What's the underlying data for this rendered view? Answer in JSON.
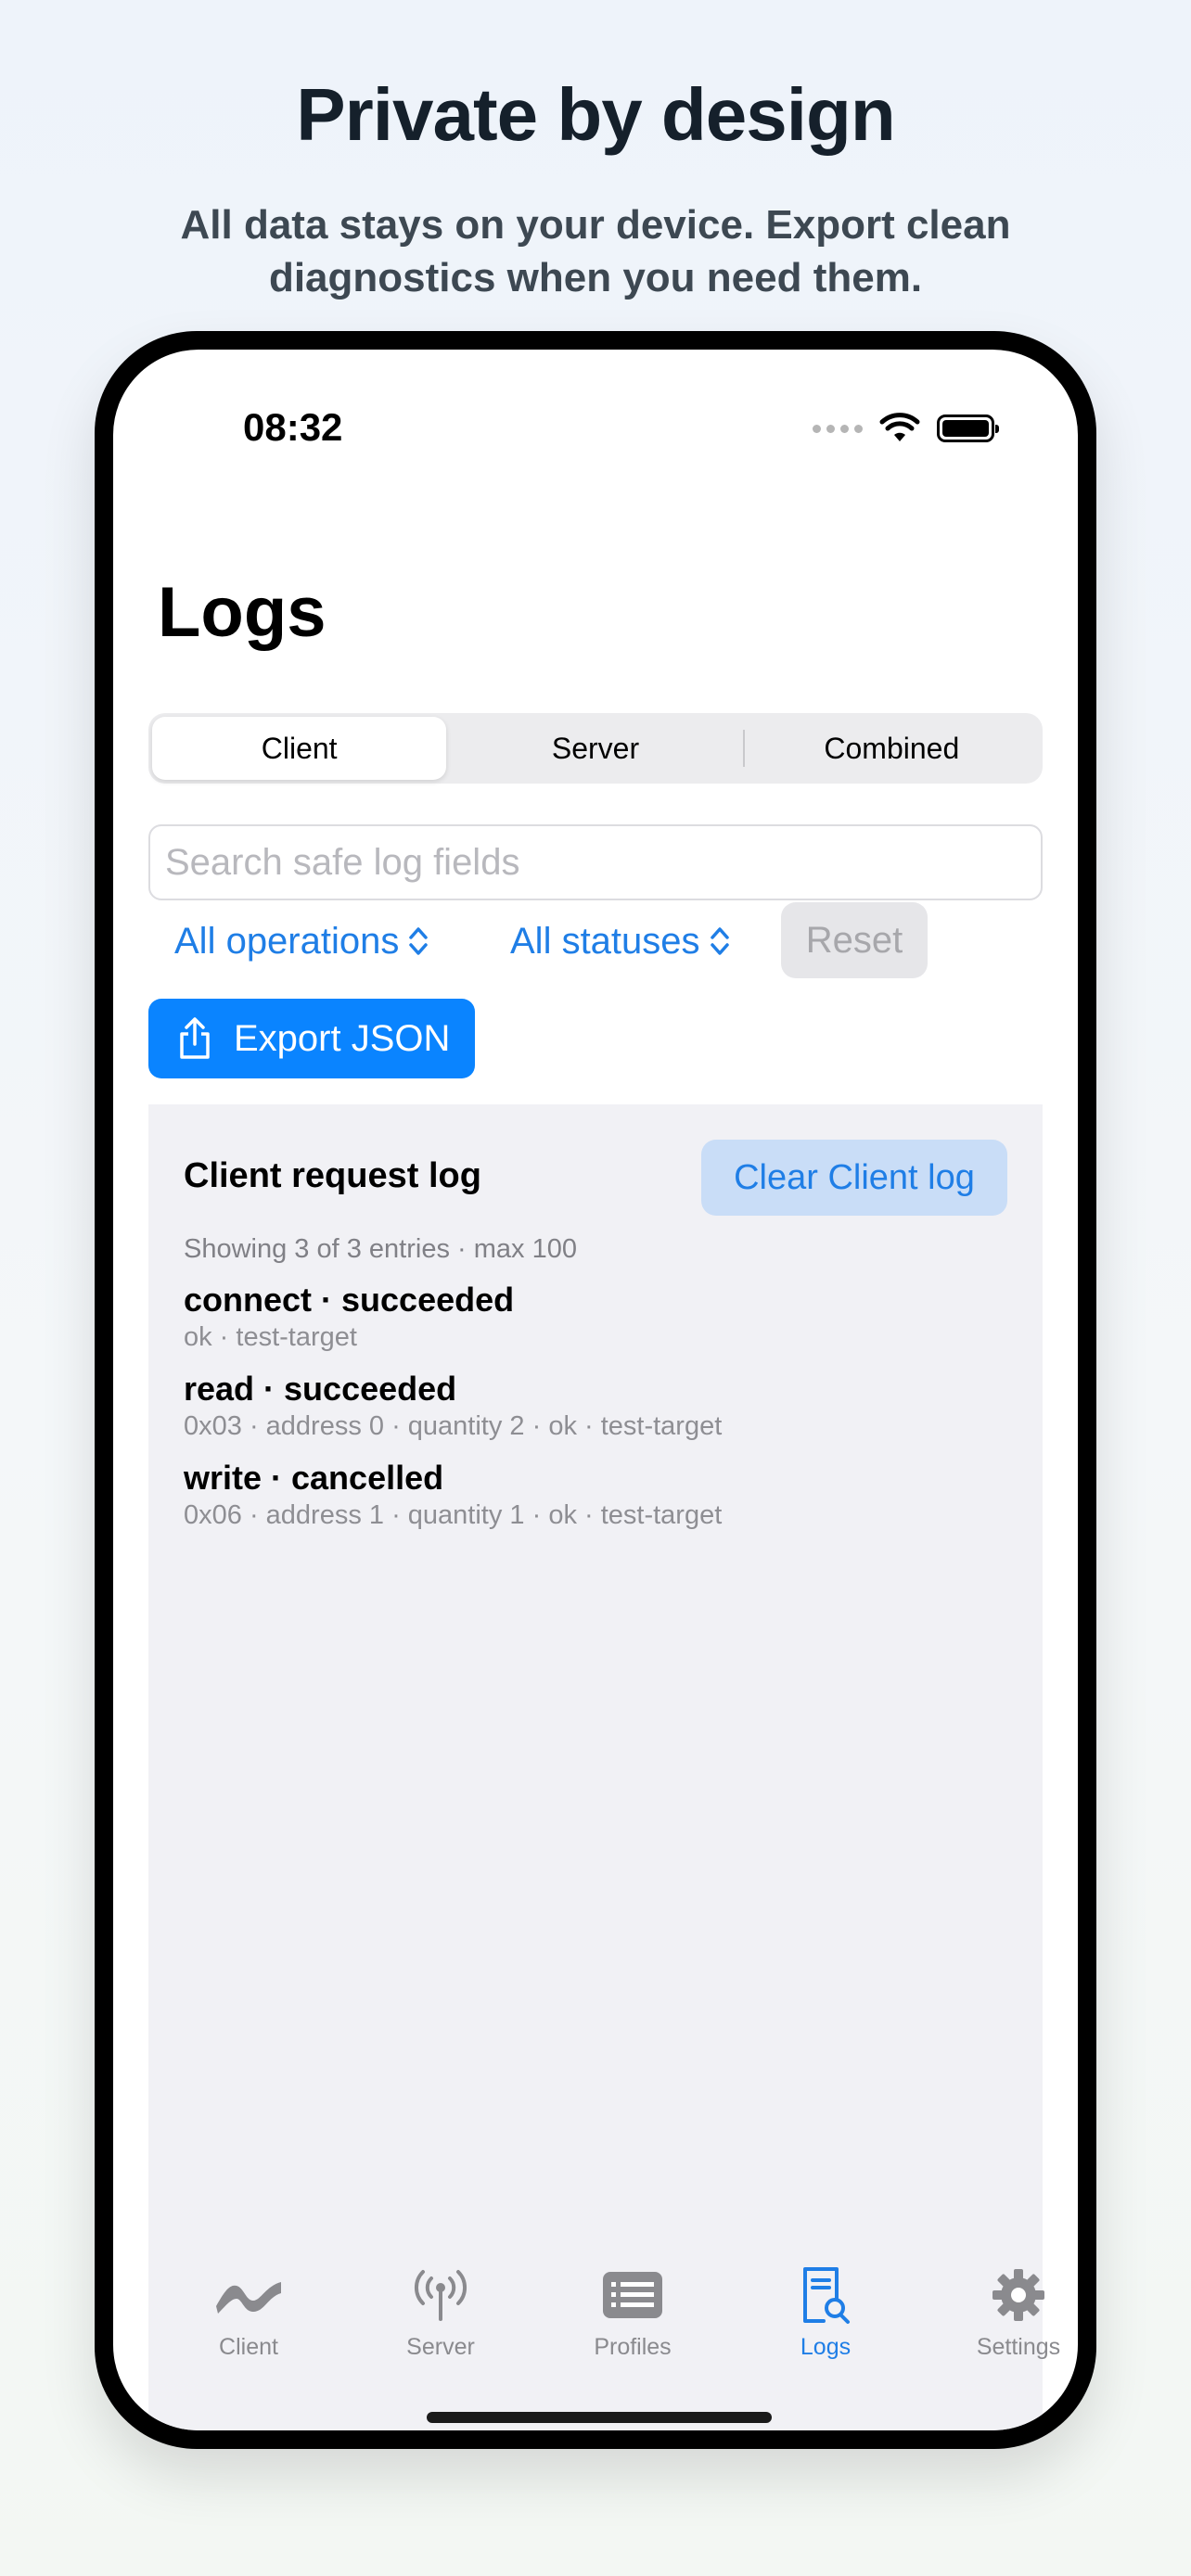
{
  "marketing": {
    "headline": "Private by design",
    "subhead": "All data stays on your device. Export clean diagnostics when you need them."
  },
  "status_bar": {
    "time": "08:32"
  },
  "page": {
    "title": "Logs"
  },
  "segments": {
    "items": [
      {
        "label": "Client",
        "selected": true
      },
      {
        "label": "Server",
        "selected": false
      },
      {
        "label": "Combined",
        "selected": false
      }
    ]
  },
  "search": {
    "placeholder": "Search safe log fields",
    "value": ""
  },
  "filters": {
    "operations": "All operations",
    "statuses": "All statuses",
    "reset": "Reset"
  },
  "export": {
    "label": "Export JSON"
  },
  "log": {
    "title": "Client request log",
    "clear_label": "Clear Client log",
    "meta": "Showing 3 of 3 entries · max 100",
    "entries": [
      {
        "title": "connect · succeeded",
        "detail": "ok · test-target"
      },
      {
        "title": "read · succeeded",
        "detail": "0x03 · address 0 · quantity 2 · ok · test-target"
      },
      {
        "title": "write · cancelled",
        "detail": "0x06 · address 1 · quantity 1 · ok · test-target"
      }
    ]
  },
  "tabbar": {
    "items": [
      {
        "label": "Client",
        "icon": "waveform-icon",
        "active": false
      },
      {
        "label": "Server",
        "icon": "antenna-icon",
        "active": false
      },
      {
        "label": "Profiles",
        "icon": "list-icon",
        "active": false
      },
      {
        "label": "Logs",
        "icon": "document-search-icon",
        "active": true
      },
      {
        "label": "Settings",
        "icon": "gear-icon",
        "active": false
      }
    ]
  },
  "colors": {
    "accent": "#0a84ff",
    "link": "#1f7ee6",
    "panel_bg": "#f1f1f5"
  }
}
